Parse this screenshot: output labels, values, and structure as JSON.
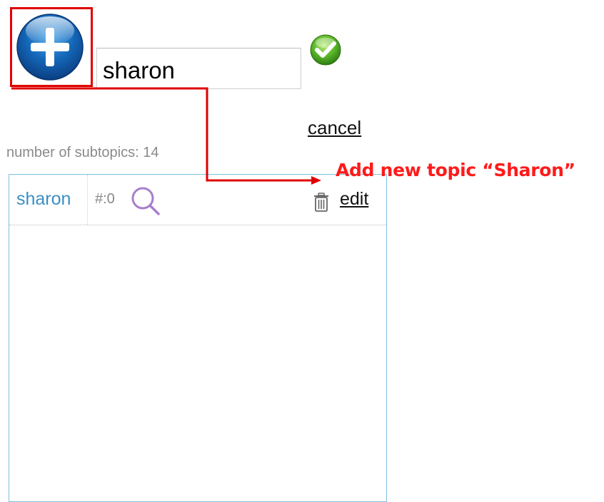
{
  "toolbar": {
    "add_icon": "plus-circle-icon",
    "input_value": "sharon",
    "confirm_icon": "check-circle-icon",
    "cancel_label": "cancel"
  },
  "subtopics": {
    "count_label": "number of subtopics: 14"
  },
  "topic_list": {
    "rows": [
      {
        "name": "sharon",
        "count": "#:0",
        "search_icon": "search-icon",
        "delete_icon": "trash-icon",
        "edit_label": "edit"
      }
    ]
  },
  "annotation": {
    "text": "Add new topic “Sharon”",
    "color": "#ff1a1a"
  },
  "colors": {
    "accent_blue": "#3b8fc4",
    "panel_border": "#7fc0e0",
    "highlight_red": "#e00000",
    "confirm_green": "#5cb82a"
  }
}
